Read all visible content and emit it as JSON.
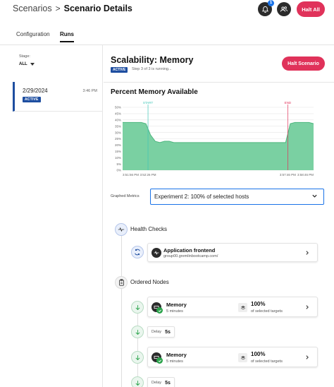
{
  "header": {
    "breadcrumb_root": "Scenarios",
    "breadcrumb_sep": ">",
    "breadcrumb_current": "Scenario Details",
    "notification_count": "1",
    "halt_all_label": "Halt All"
  },
  "tabs": [
    {
      "label": "Configuration"
    },
    {
      "label": "Runs"
    }
  ],
  "sidebar": {
    "stage_label": "Stage:",
    "stage_value": "ALL",
    "runs": [
      {
        "date": "2/29/2024",
        "time": "3:46 PM",
        "status": "ACTIVE"
      }
    ]
  },
  "scenario": {
    "title": "Scalability: Memory",
    "status": "ACTIVE",
    "step_text": "Step 3 of 3 is running...",
    "halt_label": "Halt Scenario"
  },
  "chart_section": {
    "title": "Percent Memory Available"
  },
  "chart_data": {
    "type": "area",
    "title": "Percent Memory Available",
    "y_ticks": [
      "50%",
      "45%",
      "40%",
      "35%",
      "30%",
      "25%",
      "20%",
      "15%",
      "10%",
      "5%",
      "0%"
    ],
    "ylim": [
      0,
      50
    ],
    "x_tick_labels": [
      "3:51:56 PM",
      "3:52:26 PM",
      "3:57:46 PM",
      "3:58:46 PM"
    ],
    "markers": [
      {
        "label": "START",
        "color": "#3fc6b7"
      },
      {
        "label": "END",
        "color": "#e0325a"
      }
    ],
    "series": [
      {
        "values": [
          38,
          38,
          38,
          38,
          38,
          37,
          28,
          23,
          22,
          23,
          23,
          22,
          22,
          22,
          22,
          22,
          22,
          22,
          22,
          22,
          22,
          22,
          22,
          22,
          22,
          22,
          22,
          22,
          22,
          22,
          22,
          22,
          22,
          22,
          22,
          22,
          37,
          38,
          38,
          38,
          38,
          37
        ]
      }
    ],
    "fill_color": "#7ad0a2",
    "grid": true
  },
  "graphed_metrics": {
    "label": "Graphed Metrics",
    "value": "Experiment 2: 100% of selected hosts"
  },
  "health_checks": {
    "label": "Health Checks",
    "item_title": "Application frontend",
    "item_sub": "group00.gremlinbootcamp.com/"
  },
  "ordered_nodes": {
    "label": "Ordered Nodes",
    "items": [
      {
        "title": "Memory",
        "sub": "5 minutes",
        "pct": "100%",
        "pct_sub": "of selected targets"
      },
      {
        "delay_label": "Delay",
        "delay_value": "5s"
      },
      {
        "title": "Memory",
        "sub": "5 minutes",
        "pct": "100%",
        "pct_sub": "of selected targets"
      },
      {
        "delay_label": "Delay",
        "delay_value": "5s"
      }
    ]
  }
}
